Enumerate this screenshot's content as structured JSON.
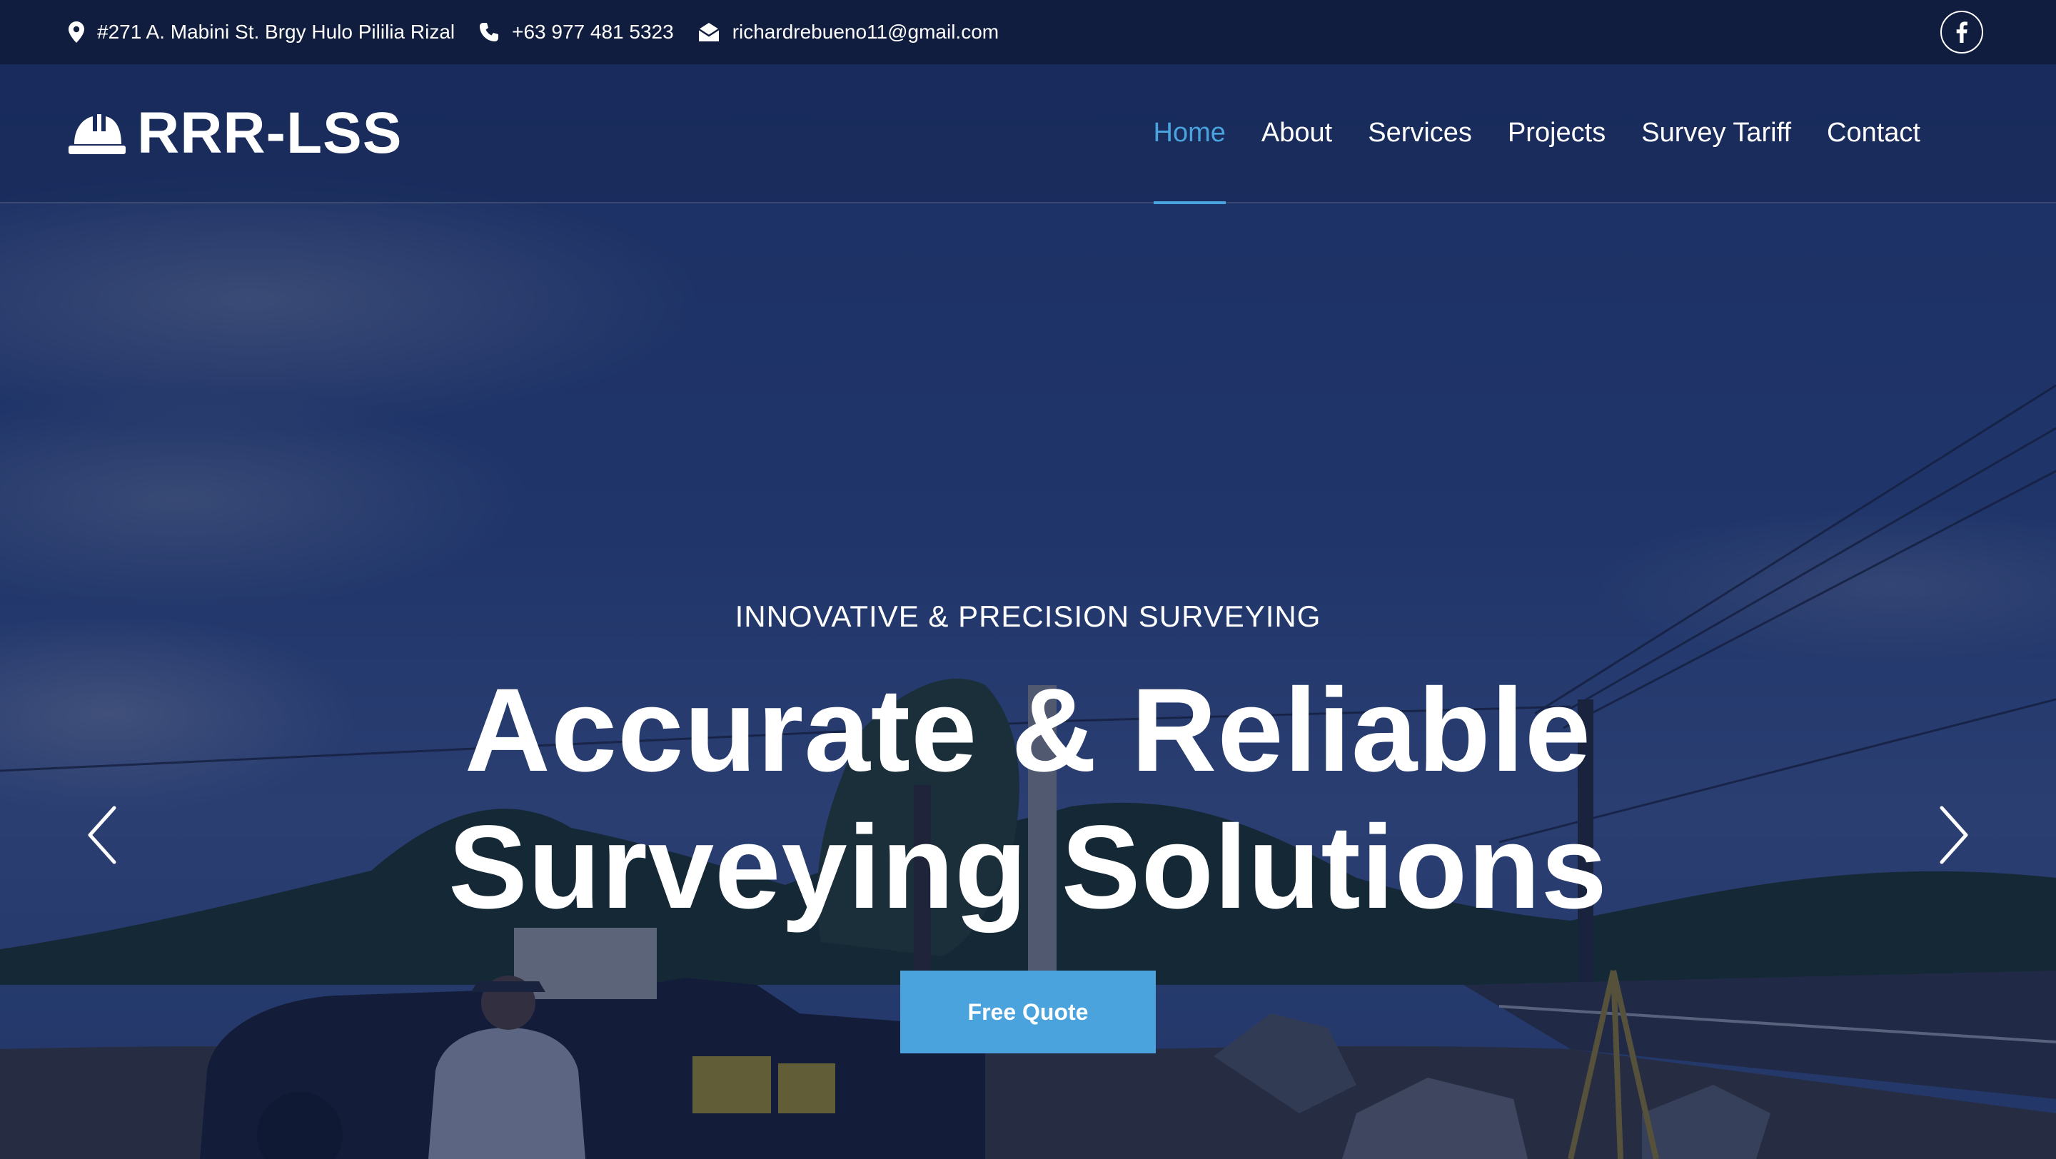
{
  "topbar": {
    "address": "#271 A. Mabini St. Brgy Hulo Pililia Rizal",
    "address_icon": "map-marker-icon",
    "phone": "+63 977 481 5323",
    "phone_icon": "phone-icon",
    "email": "richardrebueno11@gmail.com",
    "email_icon": "envelope-open-icon",
    "social_icon": "facebook-icon"
  },
  "brand": {
    "name": "RRR-LSS",
    "logo_icon": "hard-hat-icon"
  },
  "nav": {
    "items": [
      {
        "label": "Home",
        "active": true
      },
      {
        "label": "About",
        "active": false
      },
      {
        "label": "Services",
        "active": false
      },
      {
        "label": "Projects",
        "active": false
      },
      {
        "label": "Survey Tariff",
        "active": false
      },
      {
        "label": "Contact",
        "active": false
      }
    ]
  },
  "hero": {
    "kicker": "INNOVATIVE & PRECISION SURVEYING",
    "title_line1": "Accurate & Reliable",
    "title_line2": "Surveying Solutions",
    "cta_label": "Free Quote",
    "prev_icon": "chevron-left-icon",
    "next_icon": "chevron-right-icon"
  },
  "colors": {
    "topbar_bg": "#101d3f",
    "accent": "#4aa3dd",
    "overlay": "#101e48"
  }
}
